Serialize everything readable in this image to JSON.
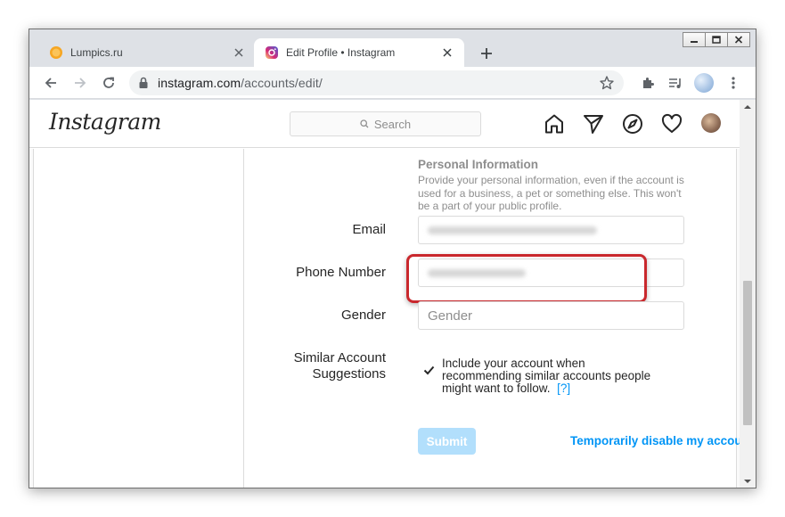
{
  "browser": {
    "tabs": [
      {
        "title": "Lumpics.ru",
        "favicon": "orange-circle-icon",
        "active": false
      },
      {
        "title": "Edit Profile • Instagram",
        "favicon": "instagram-icon",
        "active": true
      }
    ],
    "url_host": "instagram.com",
    "url_path": "/accounts/edit/"
  },
  "instagram": {
    "logo": "Instagram",
    "search_placeholder": "Search"
  },
  "form": {
    "section_title": "Personal Information",
    "section_desc": "Provide your personal information, even if the account is used for a business, a pet or something else. This won't be a part of your public profile.",
    "email_label": "Email",
    "phone_label": "Phone Number",
    "gender_label": "Gender",
    "gender_placeholder": "Gender",
    "similar_label_1": "Similar Account",
    "similar_label_2": "Suggestions",
    "similar_checkbox_text": "Include your account when recommending similar accounts people might want to follow.",
    "similar_help": "[?]",
    "submit_label": "Submit",
    "disable_link": "Temporarily disable my account"
  },
  "colors": {
    "accent": "#0095f6",
    "submit_disabled": "#b2dffc",
    "highlight": "#c9282d"
  }
}
